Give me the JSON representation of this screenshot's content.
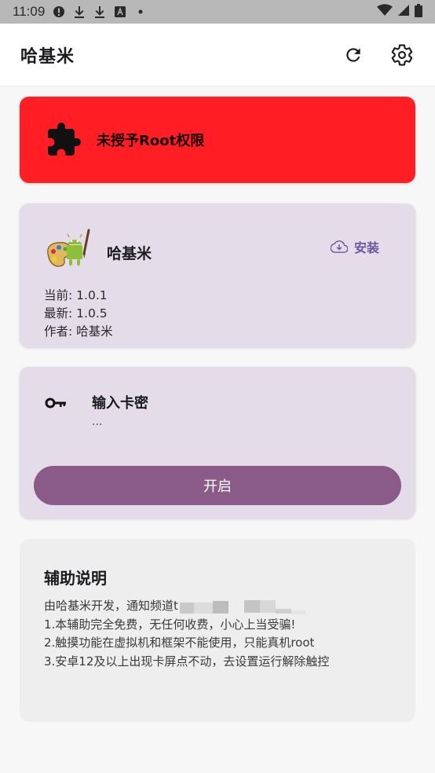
{
  "status_bar": {
    "time": "11:09",
    "icons": [
      "alert-circle-icon",
      "download-icon",
      "download-icon",
      "text-a-icon",
      "dot-icon"
    ],
    "right_icons": [
      "wifi-icon",
      "signal-icon",
      "battery-icon"
    ]
  },
  "app_bar": {
    "title": "哈基米",
    "refresh_icon": "refresh-icon",
    "settings_icon": "gear-icon"
  },
  "root_card": {
    "icon": "puzzle-icon",
    "text": "未授予Root权限",
    "color": "#ff1e24"
  },
  "app_card": {
    "icon": "android-paint-icon",
    "name": "哈基米",
    "install_label": "安装",
    "current_label": "当前:",
    "current_version": "1.0.1",
    "latest_label": "最新:",
    "latest_version": "1.0.5",
    "author_label": "作者:",
    "author": "哈基米"
  },
  "key_card": {
    "icon": "key-icon",
    "title": "输入卡密",
    "value": "...",
    "button_label": "开启",
    "button_color": "#8a5b88"
  },
  "help_card": {
    "title": "辅助说明",
    "line0": "由哈基米开发，通知频道t",
    "line1": "1.本辅助完全免费，无任何收费，小心上当受骗!",
    "line2": "2.触摸功能在虚拟机和框架不能使用，只能真机root",
    "line3": "3.安卓12及以上出现卡屏点不动，去设置运行解除触控"
  }
}
